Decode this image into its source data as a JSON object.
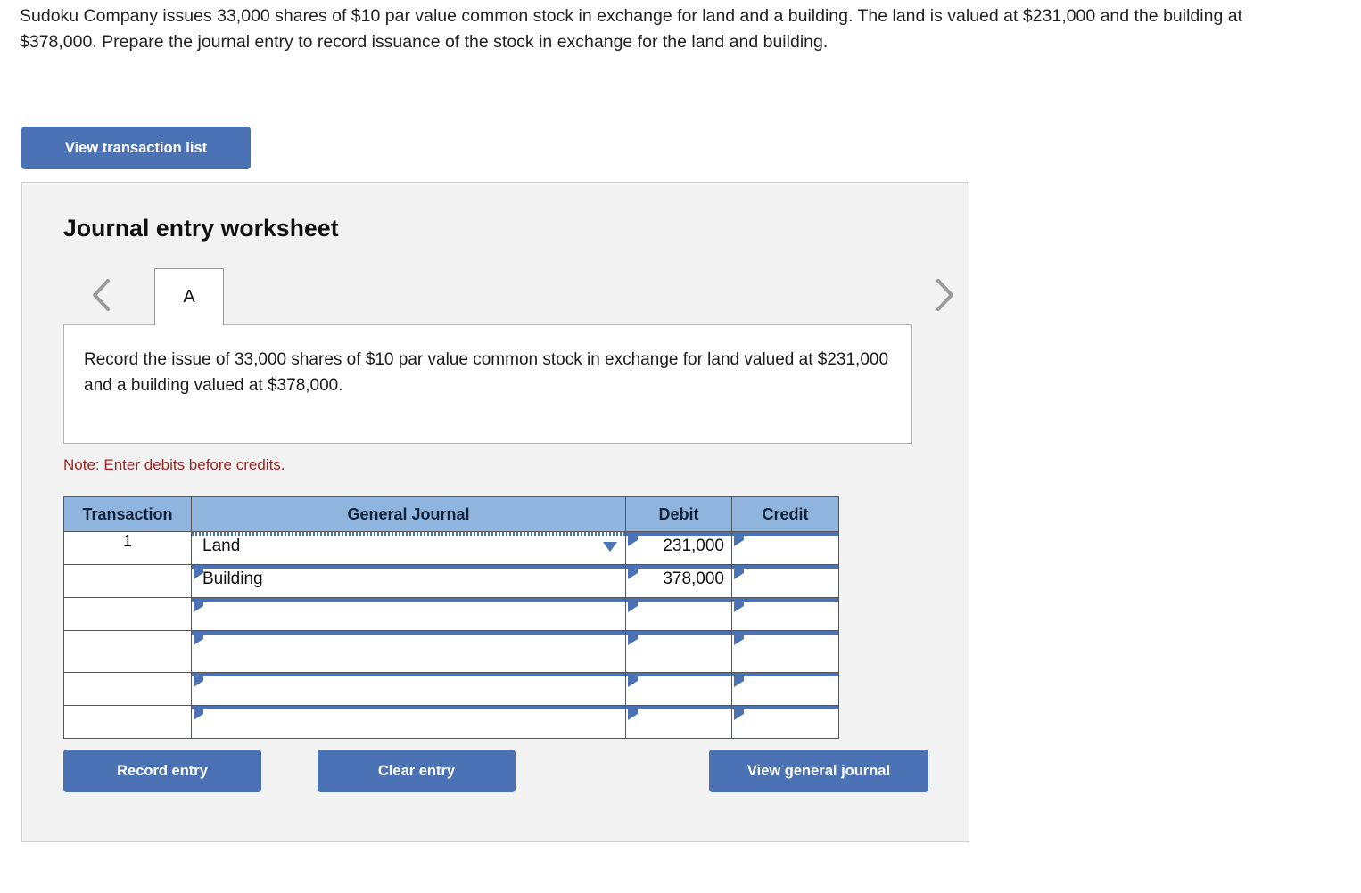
{
  "problem": {
    "statement": "Sudoku Company issues 33,000 shares of $10 par value common stock in exchange for land and a building. The land is valued at $231,000 and the building at $378,000. Prepare the journal entry to record issuance of the stock in exchange for the land and building."
  },
  "toolbar": {
    "view_transaction_list_label": "View transaction list"
  },
  "worksheet": {
    "title": "Journal entry worksheet",
    "prev_label": "‹",
    "next_label": "›",
    "tabs": [
      {
        "label": "A",
        "active": true
      }
    ],
    "instruction": "Record the issue of 33,000 shares of $10 par value common stock in exchange for land valued at $231,000 and a building valued at $378,000.",
    "note": "Note: Enter debits before credits."
  },
  "table": {
    "headers": {
      "transaction": "Transaction",
      "general_journal": "General Journal",
      "debit": "Debit",
      "credit": "Credit"
    },
    "rows": [
      {
        "transaction": "1",
        "account": "Land",
        "debit": "231,000",
        "credit": "",
        "focused": true
      },
      {
        "transaction": "",
        "account": "Building",
        "debit": "378,000",
        "credit": "",
        "focused": false
      },
      {
        "transaction": "",
        "account": "",
        "debit": "",
        "credit": "",
        "focused": false
      },
      {
        "transaction": "",
        "account": "",
        "debit": "",
        "credit": "",
        "focused": false
      },
      {
        "transaction": "",
        "account": "",
        "debit": "",
        "credit": "",
        "focused": false
      },
      {
        "transaction": "",
        "account": "",
        "debit": "",
        "credit": "",
        "focused": false
      }
    ]
  },
  "actions": {
    "record_entry_label": "Record entry",
    "clear_entry_label": "Clear entry",
    "view_general_journal_label": "View general journal"
  },
  "colors": {
    "button_blue": "#4a72b5",
    "header_blue": "#8fb4dd",
    "note_red": "#9c2323",
    "panel_bg": "#f2f2f2"
  }
}
